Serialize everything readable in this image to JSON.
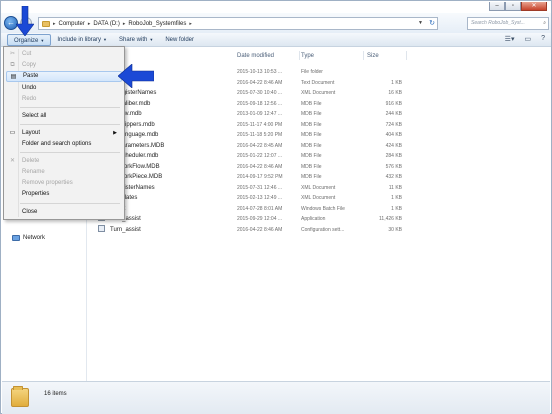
{
  "window": {
    "controls": [
      "–",
      "▫",
      "✕"
    ]
  },
  "address": {
    "crumbs": [
      "Computer",
      "DATA (D:)",
      "RoboJob_Systemfiles"
    ],
    "search_placeholder": "Search RoboJob_Syst..."
  },
  "toolbar": {
    "organize": "Organize",
    "include": "Include in library",
    "share": "Share with",
    "new_folder": "New folder"
  },
  "columns": {
    "date": "Date modified",
    "type": "Type",
    "size": "Size"
  },
  "files": [
    {
      "name": "",
      "date": "2015-10-13 10:53 ...",
      "type": "File folder",
      "size": ""
    },
    {
      "name": "",
      "date": "2016-04-22 8:46 AM",
      "type": "Text Document",
      "size": "1 KB"
    },
    {
      "name": "t_RegisterNames",
      "date": "2015-07-30 10:40 ...",
      "type": "XML Document",
      "size": "16 KB"
    },
    {
      "name": "ob Caliber.mdb",
      "date": "2015-09-18 12:56 ...",
      "type": "MDB File",
      "size": "916 KB"
    },
    {
      "name": "ob Env.mdb",
      "date": "2013-01-09 12:47 ...",
      "type": "MDB File",
      "size": "244 KB"
    },
    {
      "name": "ob Grippers.mdb",
      "date": "2015-11-17 4:00 PM",
      "type": "MDB File",
      "size": "724 KB"
    },
    {
      "name": "ob Language.mdb",
      "date": "2015-11-18 5:20 PM",
      "type": "MDB File",
      "size": "404 KB"
    },
    {
      "name": "ob Parameters.MDB",
      "date": "2016-04-22 8:45 AM",
      "type": "MDB File",
      "size": "424 KB"
    },
    {
      "name": "ob Scheduler.mdb",
      "date": "2015-01-22 12:07 ...",
      "type": "MDB File",
      "size": "284 KB"
    },
    {
      "name": "ob WorkFlow.MDB",
      "date": "2016-04-22 8:46 AM",
      "type": "MDB File",
      "size": "576 KB"
    },
    {
      "name": "ob WorkPiece.MDB",
      "date": "2014-09-17 9:52 PM",
      "type": "MDB File",
      "size": "432 KB"
    },
    {
      "name": "_RegisterNames",
      "date": "2015-07-31 12:46 ...",
      "type": "XML Document",
      "size": "11 KB"
    },
    {
      "name": "Templates",
      "date": "2015-02-13 12:49 ...",
      "type": "XML Document",
      "size": "1 KB"
    },
    {
      "name": "assist",
      "date": "2014-07-28 8:01 AM",
      "type": "Windows Batch File",
      "size": "1 KB"
    },
    {
      "name": "Turn_assist",
      "date": "2015-09-29 12:04 ...",
      "type": "Application",
      "size": "11,426 KB"
    },
    {
      "name": "Turn_assist",
      "date": "2016-04-22 8:46 AM",
      "type": "Configuration sett...",
      "size": "30 KB"
    }
  ],
  "menu": {
    "cut": "Cut",
    "copy": "Copy",
    "paste": "Paste",
    "undo": "Undo",
    "redo": "Redo",
    "select_all": "Select all",
    "layout": "Layout",
    "folder_options": "Folder and search options",
    "delete": "Delete",
    "rename": "Rename",
    "remove_properties": "Remove properties",
    "properties": "Properties",
    "close": "Close"
  },
  "nav": {
    "network": "Network"
  },
  "status": {
    "count": "16 items"
  },
  "colors": {
    "arrow": "#1b49d6",
    "menu_highlight": "#d3e6fb"
  }
}
